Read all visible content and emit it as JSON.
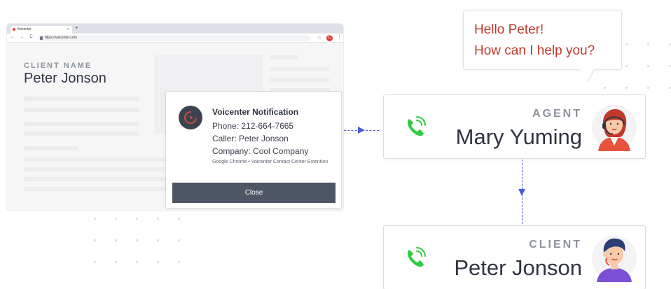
{
  "browser": {
    "tab_title": "Voicenter",
    "tab_close": "×",
    "new_tab": "+",
    "nav_icons": "← → C",
    "url": "https://voicenter.com",
    "star": "☆",
    "extension_letter": "C",
    "menu": "⋮"
  },
  "crm": {
    "client_label": "CLIENT NAME",
    "client_name": "Peter Jonson"
  },
  "notification": {
    "title": "Voicenter Notification",
    "phone": "Phone: 212-664-7665",
    "caller": "Caller: Peter Jonson",
    "company": "Company: Cool Company",
    "footer": "Google Chrome • Voicenter Contact Center Extention",
    "close_label": "Close"
  },
  "bubble": {
    "line1": "Hello Peter!",
    "line2": "How can I help you?"
  },
  "agent_card": {
    "role": "AGENT",
    "name": "Mary Yuming"
  },
  "client_card": {
    "role": "CLIENT",
    "name": "Peter Jonson"
  },
  "colors": {
    "accent_red": "#c0392b",
    "phone_green": "#2ecc40",
    "connector_blue": "#4a5bd6",
    "button_dark": "#4e5564"
  }
}
